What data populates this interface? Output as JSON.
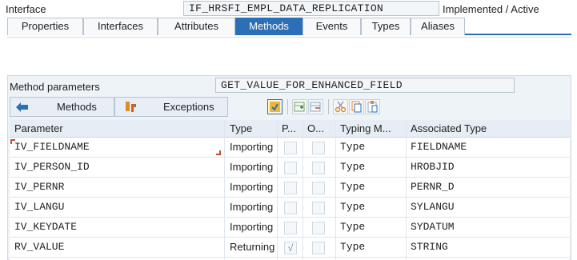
{
  "interface": {
    "label": "Interface",
    "name": "IF_HRSFI_EMPL_DATA_REPLICATION",
    "status": "Implemented / Active"
  },
  "tabs": [
    {
      "label": "Properties",
      "active": false
    },
    {
      "label": "Interfaces",
      "active": false
    },
    {
      "label": "Attributes",
      "active": false
    },
    {
      "label": "Methods",
      "active": true
    },
    {
      "label": "Events",
      "active": false
    },
    {
      "label": "Types",
      "active": false
    },
    {
      "label": "Aliases",
      "active": false
    }
  ],
  "method_parameters": {
    "label": "Method parameters",
    "value": "GET_VALUE_FOR_ENHANCED_FIELD"
  },
  "toolbar": {
    "methods_label": "Methods",
    "exceptions_label": "Exceptions"
  },
  "grid": {
    "columns": [
      "Parameter",
      "Type",
      "P...",
      "O...",
      "Typing M...",
      "Associated Type"
    ],
    "rows": [
      {
        "parameter": "IV_FIELDNAME",
        "type": "Importing",
        "pass_by_value": false,
        "optional": false,
        "typing": "Type",
        "associated": "FIELDNAME"
      },
      {
        "parameter": "IV_PERSON_ID",
        "type": "Importing",
        "pass_by_value": false,
        "optional": false,
        "typing": "Type",
        "associated": "HROBJID"
      },
      {
        "parameter": "IV_PERNR",
        "type": "Importing",
        "pass_by_value": false,
        "optional": false,
        "typing": "Type",
        "associated": "PERNR_D"
      },
      {
        "parameter": "IV_LANGU",
        "type": "Importing",
        "pass_by_value": false,
        "optional": false,
        "typing": "Type",
        "associated": "SYLANGU"
      },
      {
        "parameter": "IV_KEYDATE",
        "type": "Importing",
        "pass_by_value": false,
        "optional": false,
        "typing": "Type",
        "associated": "SYDATUM"
      },
      {
        "parameter": "RV_VALUE",
        "type": "Returning",
        "pass_by_value": true,
        "optional": false,
        "typing": "Type",
        "associated": "STRING"
      }
    ]
  },
  "colors": {
    "accent": "#2c6fb6",
    "focus": "#c64b34"
  }
}
